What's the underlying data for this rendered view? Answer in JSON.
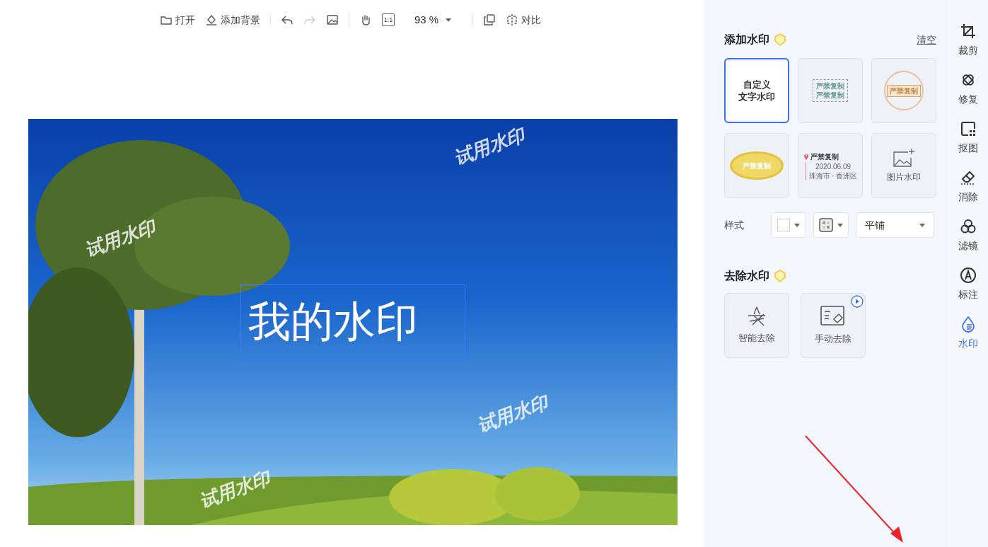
{
  "toolbar": [
    {
      "kind": "open",
      "label": "打开",
      "disabled": false
    },
    {
      "kind": "background",
      "label": "添加背景",
      "disabled": false
    },
    {
      "kind": "divider"
    },
    {
      "kind": "undo",
      "disabled": false
    },
    {
      "kind": "redo",
      "disabled": true
    },
    {
      "kind": "image",
      "disabled": false
    },
    {
      "kind": "divider"
    },
    {
      "kind": "hand",
      "disabled": false
    },
    {
      "kind": "actual-size",
      "label": "1:1",
      "disabled": false
    },
    {
      "kind": "zoom",
      "label": "93 %",
      "disabled": false
    },
    {
      "kind": "divider"
    },
    {
      "kind": "copy",
      "disabled": false
    },
    {
      "kind": "compare",
      "label": "对比",
      "disabled": false
    }
  ],
  "canvas": {
    "trial_watermarks": [
      "试用水印",
      "试用水印",
      "试用水印",
      "试用水印"
    ],
    "text_box": "我的水印"
  },
  "add_watermark": {
    "title": "添加水印",
    "clear": "清空",
    "templates": [
      {
        "kind": "custom",
        "lines": [
          "自定义",
          "文字水印"
        ],
        "selected": true
      },
      {
        "kind": "frame",
        "lines": [
          "严禁复制",
          "严禁复制"
        ],
        "selected": false
      },
      {
        "kind": "seal",
        "lines": [
          "严禁复制"
        ],
        "selected": false
      },
      {
        "kind": "oval",
        "lines": [
          "严禁复制"
        ],
        "selected": false
      },
      {
        "kind": "location",
        "lines": [
          "严禁复制",
          "2020.06.09",
          "珠海市 · 香洲区"
        ],
        "selected": false
      },
      {
        "kind": "picture",
        "lines": [
          "图片水印"
        ],
        "selected": false
      }
    ],
    "style_label": "样式",
    "layout_value": "平铺"
  },
  "remove_watermark": {
    "title": "去除水印",
    "tools": [
      {
        "kind": "smart",
        "label": "智能去除",
        "video": false
      },
      {
        "kind": "manual",
        "label": "手动去除",
        "video": true
      }
    ]
  },
  "sidebar": [
    {
      "kind": "crop",
      "label": "裁剪",
      "selected": false
    },
    {
      "kind": "repair",
      "label": "修复",
      "selected": false
    },
    {
      "kind": "cutout",
      "label": "抠图",
      "selected": false
    },
    {
      "kind": "erase",
      "label": "消除",
      "selected": false
    },
    {
      "kind": "filter",
      "label": "滤镜",
      "selected": false
    },
    {
      "kind": "annotate",
      "label": "标注",
      "selected": false
    },
    {
      "kind": "watermark",
      "label": "水印",
      "selected": true
    }
  ]
}
